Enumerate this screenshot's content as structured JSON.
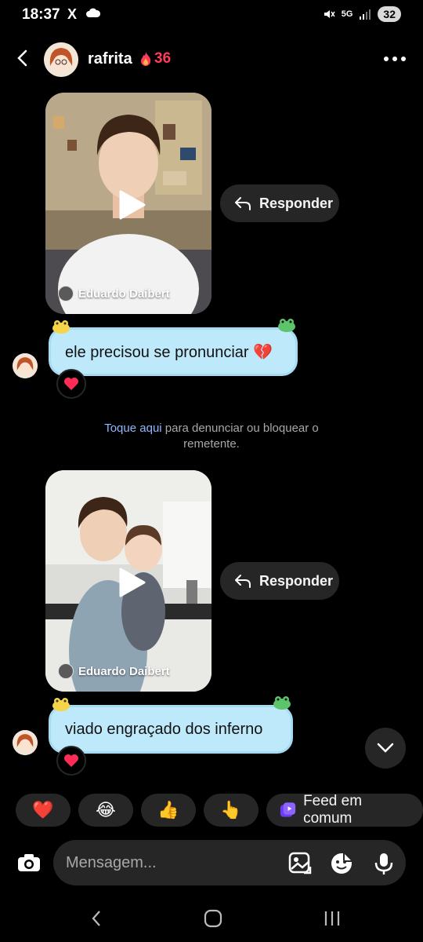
{
  "status": {
    "time": "18:37",
    "x_logo": "X",
    "network": "5G",
    "battery": "32"
  },
  "header": {
    "username": "rafrita",
    "streak": "36"
  },
  "videos": [
    {
      "credit": "Eduardo Daibert",
      "reply_label": "Responder"
    },
    {
      "credit": "Eduardo Daibert",
      "reply_label": "Responder"
    }
  ],
  "messages": [
    {
      "text": "ele precisou se pronunciar 💔",
      "reaction": "❤️"
    },
    {
      "text": "viado engraçado dos inferno",
      "reaction": "❤️"
    }
  ],
  "notice": {
    "link": "Toque aqui",
    "text": " para denunciar ou bloquear o",
    "text2": "remetente."
  },
  "quick_reactions": [
    "❤️",
    "😂",
    "👍",
    "👆"
  ],
  "feed_chip": "Feed em comum",
  "composer": {
    "placeholder": "Mensagem..."
  },
  "colors": {
    "bubble": "#bde9fb",
    "streak": "#ff3b5c",
    "link": "#8fb8ff"
  }
}
